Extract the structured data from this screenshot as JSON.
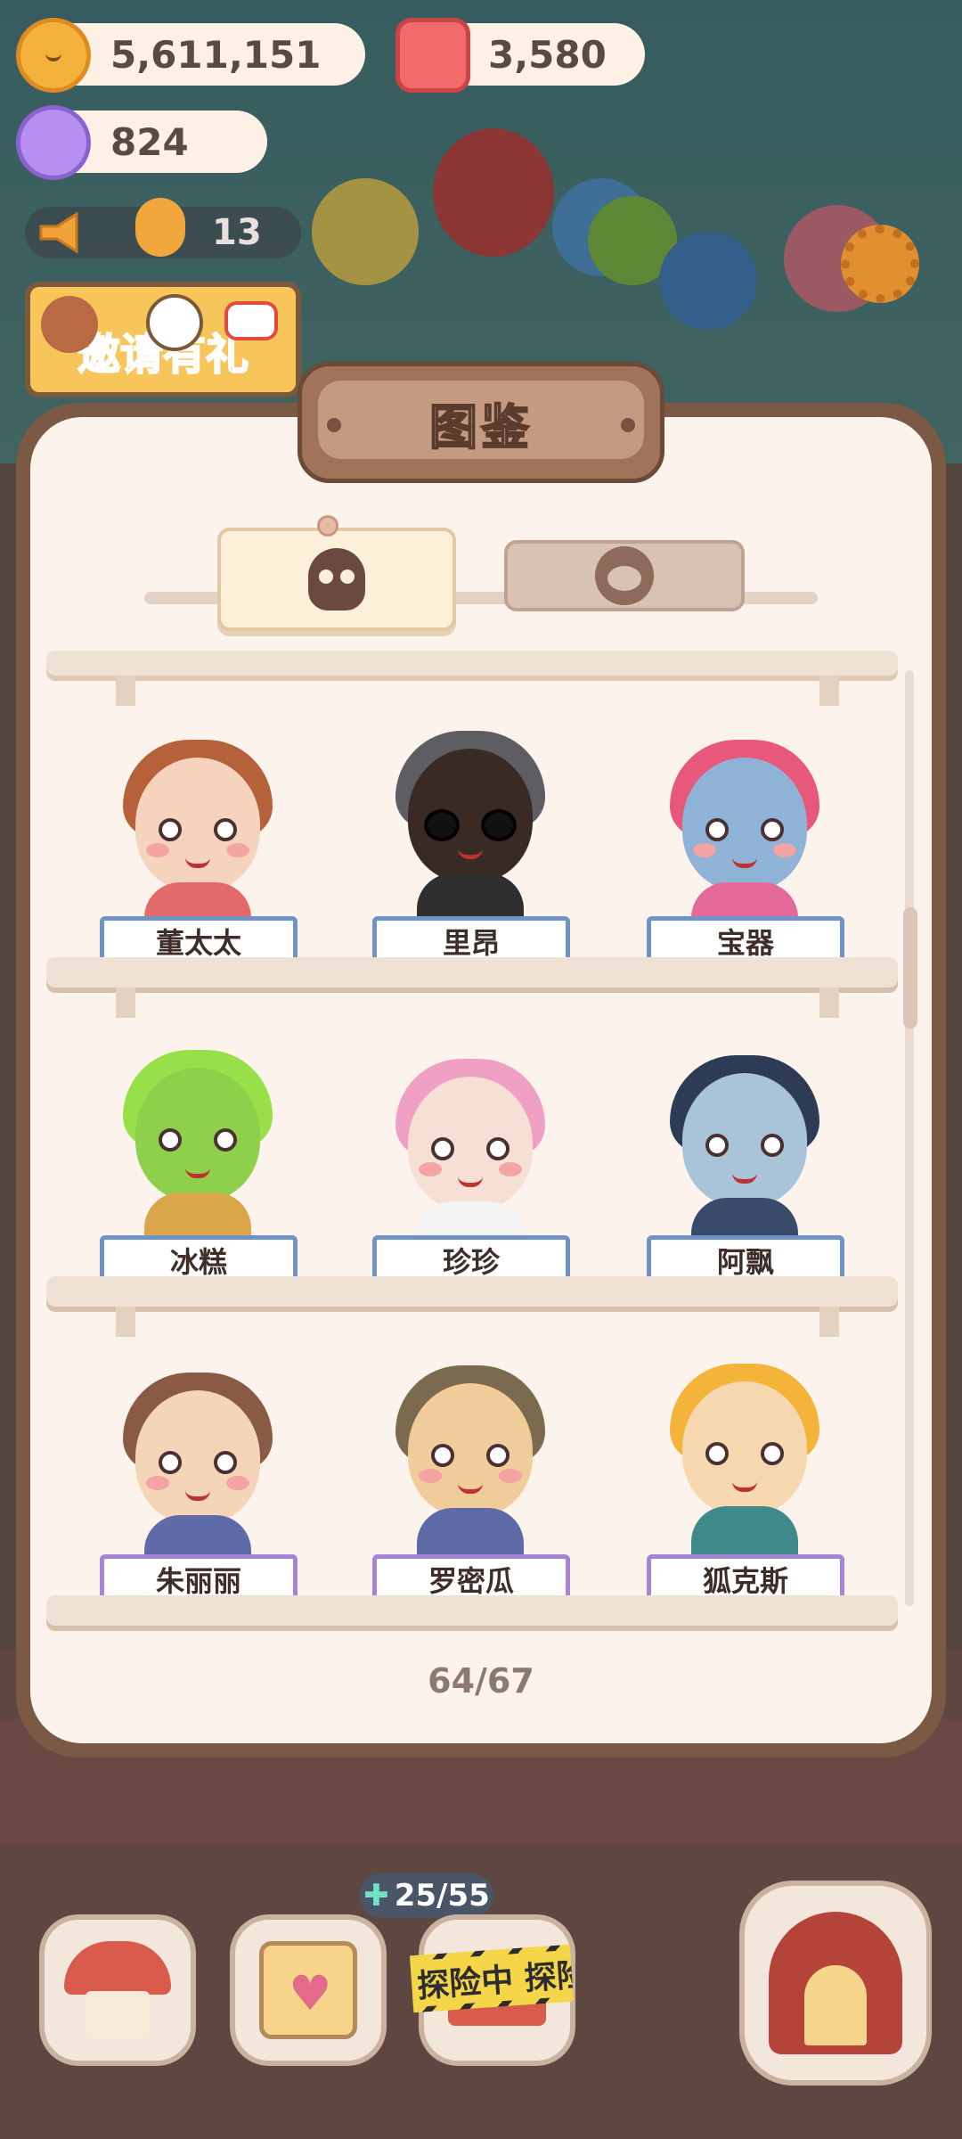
{
  "hud": {
    "cookies": "5,611,151",
    "jelly": "3,580",
    "candy": "824",
    "announcement_count": "13"
  },
  "invite": {
    "label": "邀请有礼"
  },
  "dialog": {
    "title": "图鉴",
    "progress": "64/67",
    "tabs": [
      {
        "icon": "skull-icon",
        "active": true
      },
      {
        "icon": "face-icon",
        "active": false
      }
    ]
  },
  "characters": [
    {
      "name": "董太太",
      "hair": "#b5623a",
      "skin": "#f6d3bd",
      "outfit": "#e46a6a",
      "frame": "blue"
    },
    {
      "name": "里昂",
      "hair": "#5d5d62",
      "skin": "#3a2a24",
      "outfit": "#2e2e2e",
      "frame": "blue"
    },
    {
      "name": "宝器",
      "hair": "#e8587a",
      "skin": "#8fb3d6",
      "outfit": "#e46a9a",
      "frame": "blue"
    },
    {
      "name": "冰糕",
      "hair": "#98e04a",
      "skin": "#8ed04a",
      "outfit": "#d9a64a",
      "frame": "blue"
    },
    {
      "name": "珍珍",
      "hair": "#f0a0c4",
      "skin": "#f6e0d6",
      "outfit": "#f4f4f4",
      "frame": "blue"
    },
    {
      "name": "阿飘",
      "hair": "#2e3b55",
      "skin": "#a9c3d8",
      "outfit": "#3a4a6a",
      "frame": "blue"
    },
    {
      "name": "朱丽丽",
      "hair": "#8a5a44",
      "skin": "#f4d5b8",
      "outfit": "#5f6aa8",
      "frame": "purple"
    },
    {
      "name": "罗密瓜",
      "hair": "#7b6a50",
      "skin": "#f0cc9a",
      "outfit": "#5f6aa8",
      "frame": "purple"
    },
    {
      "name": "狐克斯",
      "hair": "#f4b43a",
      "skin": "#f6d8b0",
      "outfit": "#3e8a8a",
      "frame": "purple"
    }
  ],
  "bottom_bar": {
    "energy": "25/55",
    "expedition_label": "探险中 探险"
  },
  "colors": {
    "dialog_frame": "#7a5a45",
    "dialog_bg": "#fbf3ec",
    "label_blue": "#6f93c9",
    "label_purple": "#a583d6"
  }
}
